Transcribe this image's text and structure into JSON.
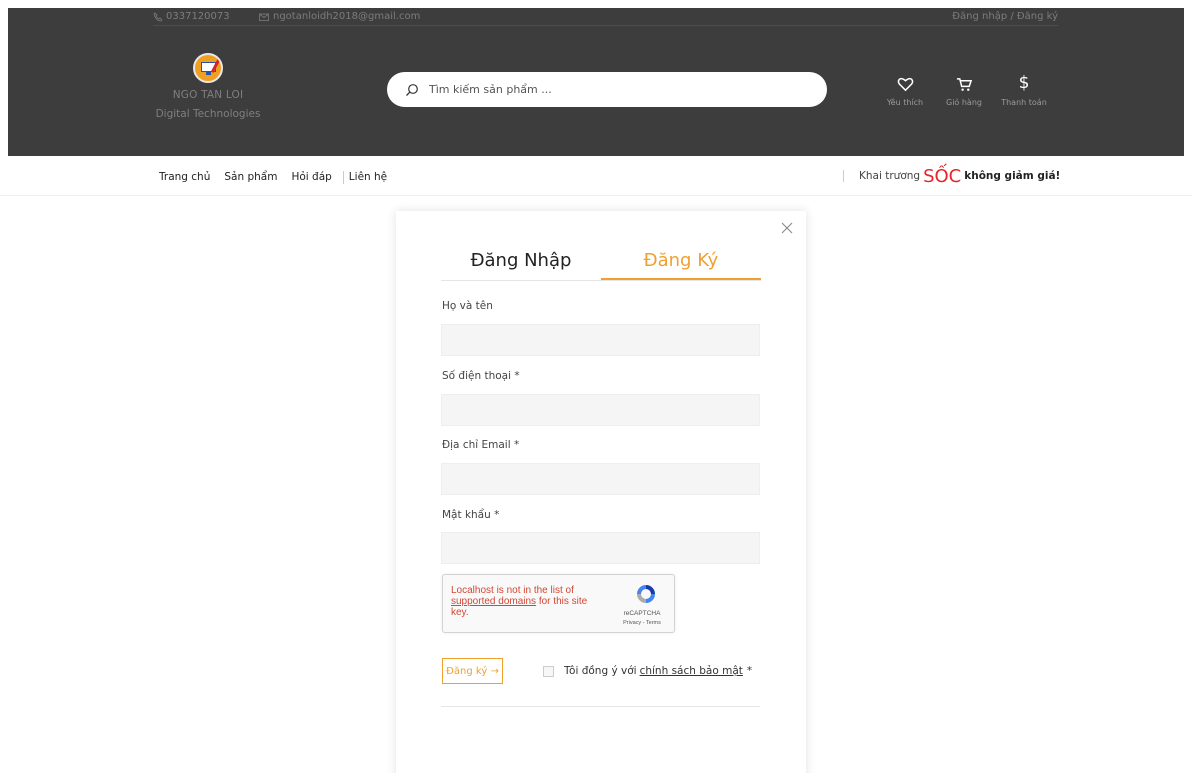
{
  "topbar": {
    "phone": "0337120073",
    "email": "ngotanloidh2018@gmail.com",
    "auth": "Đăng nhập / Đăng ký"
  },
  "brand": {
    "name": "NGO TAN LOI",
    "subtitle": "Digital Technologies"
  },
  "search": {
    "placeholder": "Tìm kiếm sản phẩm ..."
  },
  "header_icons": [
    {
      "label": "Yêu thích",
      "icon": "heart-icon"
    },
    {
      "label": "Giỏ hàng",
      "icon": "cart-icon"
    },
    {
      "label": "Thanh toán",
      "icon": "dollar-icon",
      "glyph": "$"
    }
  ],
  "nav": {
    "items": [
      "Trang chủ",
      "Sản phẩm",
      "Hỏi đáp",
      "Liên hệ"
    ],
    "promo": {
      "prefix": "Khai trương",
      "highlight": "SỐC",
      "suffix": "không giảm giá!"
    }
  },
  "modal": {
    "tabs": [
      {
        "label": "Đăng Nhập",
        "active": false
      },
      {
        "label": "Đăng Ký",
        "active": true
      }
    ],
    "fields": [
      {
        "label": "Họ và tên",
        "value": ""
      },
      {
        "label": "Số điện thoại *",
        "value": ""
      },
      {
        "label": "Địa chỉ Email *",
        "value": ""
      },
      {
        "label": "Mật khẩu *",
        "value": ""
      }
    ],
    "recaptcha": {
      "error_prefix": "Localhost is not in the list of",
      "error_link": "supported domains",
      "error_suffix": "for this site key.",
      "brand": "reCAPTCHA",
      "terms": "Privacy - Terms"
    },
    "submit_label": "Đăng ký →",
    "agree_text": "Tôi đồng ý với",
    "policy_link": "chính sách bảo mật",
    "required_mark": "*"
  },
  "colors": {
    "header_bg": "#3d3d3d",
    "accent": "#f0a030",
    "promo_red": "#e8232a"
  }
}
